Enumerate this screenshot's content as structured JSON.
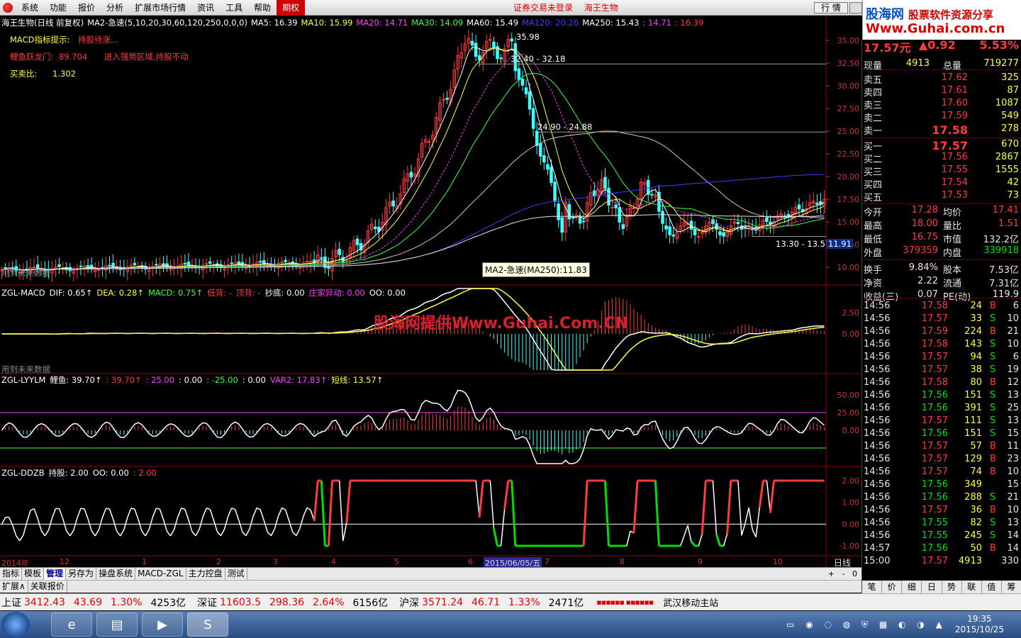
{
  "menu": {
    "items": [
      "系统",
      "功能",
      "报价",
      "分析",
      "扩展市场行情",
      "资讯",
      "工具",
      "帮助",
      "期权"
    ],
    "center_left": "证券交易未登录",
    "center_right": "海王生物",
    "hq_button": "行 情"
  },
  "site_logo": {
    "line1": "股海网",
    "line1_sub": "股票软件资源分享",
    "line2": "Www.Guhai.com.cn"
  },
  "ma_legend": [
    {
      "text": "海王生物(日线 前复权)",
      "color": "#ffffff"
    },
    {
      "text": "MA2-急速(5,10,20,30,60,120,250,0,0,0)",
      "color": "#ffffff"
    },
    {
      "text": "MA5: 16.39",
      "color": "#ffffff"
    },
    {
      "text": "MA10: 15.99",
      "color": "#ffff3c"
    },
    {
      "text": "MA20: 14.71",
      "color": "#ff3cff"
    },
    {
      "text": "MA30: 14.09",
      "color": "#3cff3c"
    },
    {
      "text": "MA60: 15.49",
      "color": "#ffffff"
    },
    {
      "text": "MA120: 20.26",
      "color": "#3c3cff"
    },
    {
      "text": "MA250: 15.43",
      "color": "#ffffff"
    },
    {
      "text": ": 14.71",
      "color": "#ff3cff"
    },
    {
      "text": ": 16.39",
      "color": "#ff3c3c"
    }
  ],
  "notes": [
    {
      "label": "MACD指标提示:",
      "value": "持股待涨...",
      "label_color": "#ffff3c",
      "value_color": "#ff3c3c"
    },
    {
      "label": "鲤鱼跃龙门:",
      "value": "89.704",
      "extra": "进入强势区域,持股不动",
      "label_color": "#ff3c3c",
      "value_color": "#ff3c3c"
    },
    {
      "label": "买卖比:",
      "value": "1.302",
      "label_color": "#ffff3c",
      "value_color": "#ffff3c"
    }
  ],
  "price_annotations": [
    "35.98",
    "32.40 - 32.18",
    "24.90 - 24.88",
    "13.30 - 13.57",
    "11.91"
  ],
  "future_data_note": "用到未来数据",
  "tooltip": "MA2-急速(MA250):11.83",
  "watermark": "股海网提供Www.Guhai.Com.CN",
  "macd_header": [
    {
      "text": "ZGL-MACD",
      "color": "#ffffff"
    },
    {
      "text": "DIF: 0.65↑",
      "color": "#ffffff"
    },
    {
      "text": "DEA: 0.28↑",
      "color": "#ffff3c"
    },
    {
      "text": "MACD: 0.75↑",
      "color": "#3cff3c"
    },
    {
      "text": "低背: -",
      "color": "#ff3c3c"
    },
    {
      "text": "顶背: -",
      "color": "#ff3c3c"
    },
    {
      "text": "抄底: 0.00",
      "color": "#ffffff"
    },
    {
      "text": "庄家异动: 0.00",
      "color": "#ff3cff"
    },
    {
      "text": "OO: 0.00",
      "color": "#ffffff"
    }
  ],
  "lyylm_header": [
    {
      "text": "ZGL-LYYLM",
      "color": "#ffffff"
    },
    {
      "text": "鲤鱼: 39.70↑",
      "color": "#ffffff"
    },
    {
      "text": ": 39.70↑",
      "color": "#ff3c3c"
    },
    {
      "text": ": 25.00",
      "color": "#ff3cff"
    },
    {
      "text": ": 0.00",
      "color": "#ffffff"
    },
    {
      "text": ": -25.00",
      "color": "#3cff3c"
    },
    {
      "text": ": 0.00",
      "color": "#ffffff"
    },
    {
      "text": "VAR2: 17.83↑",
      "color": "#ff3cff"
    },
    {
      "text": "短线: 13.57↑",
      "color": "#ffff3c"
    }
  ],
  "ddzb_header": [
    {
      "text": "ZGL-DDZB",
      "color": "#ffffff"
    },
    {
      "text": "持股: 2.00",
      "color": "#ffffff"
    },
    {
      "text": "OO: 0.00",
      "color": "#ffffff"
    },
    {
      "text": ": 2.00",
      "color": "#ff3c3c"
    }
  ],
  "axes": {
    "price_ticks": [
      "35.00",
      "32.50",
      "30.00",
      "27.50",
      "25.00",
      "22.50",
      "20.00",
      "17.50",
      "15.00",
      "12.50",
      "10.00"
    ],
    "macd_ticks": [
      "2.50",
      "0.00"
    ],
    "lyylm_ticks": [
      "50.00",
      "25.00",
      "0.00"
    ],
    "ddzb_ticks": [
      "2.00",
      "1.00",
      "0.00",
      "-1.00"
    ],
    "x_labels": [
      "2014年",
      "12",
      "1",
      "2",
      "3",
      "4",
      "5",
      "6",
      "2015/06/05/五",
      "7",
      "8",
      "9",
      "10"
    ],
    "period": "日线"
  },
  "bottom_tabs": [
    "指标",
    "模板",
    "管理",
    "另存为",
    "操盘系统",
    "MACD-ZGL",
    "主力控盘",
    "测试"
  ],
  "bottom_tabs2": [
    "扩展∧",
    "关联报价"
  ],
  "bottom_controls": [
    "+",
    "-",
    "0"
  ],
  "quote": {
    "last_price_partial": "17.57元",
    "change_partial": "▲0.92",
    "pct_partial": "5.53%",
    "summary_top": [
      {
        "k1": "现量",
        "v1": "4913",
        "k2": "总量",
        "v2": "719277"
      }
    ],
    "asks": [
      {
        "label": "卖五",
        "price": "17.62",
        "vol": "325"
      },
      {
        "label": "卖四",
        "price": "17.61",
        "vol": "87"
      },
      {
        "label": "卖三",
        "price": "17.60",
        "vol": "1087"
      },
      {
        "label": "卖二",
        "price": "17.59",
        "vol": "549"
      },
      {
        "label": "卖一",
        "price": "17.58",
        "vol": "278"
      }
    ],
    "bids": [
      {
        "label": "买一",
        "price": "17.57",
        "vol": "670"
      },
      {
        "label": "买二",
        "price": "17.56",
        "vol": "2867"
      },
      {
        "label": "买三",
        "price": "17.55",
        "vol": "1555"
      },
      {
        "label": "买四",
        "price": "17.54",
        "vol": "42"
      },
      {
        "label": "买五",
        "price": "17.53",
        "vol": "73"
      }
    ],
    "stats": [
      {
        "k1": "今开",
        "v1": "17.28",
        "c1": "#ff3c3c",
        "k2": "均价",
        "v2": "17.41",
        "c2": "#ff3c3c"
      },
      {
        "k1": "最高",
        "v1": "18.00",
        "c1": "#ff3c3c",
        "k2": "量比",
        "v2": "1.51",
        "c2": "#ff3c3c"
      },
      {
        "k1": "最低",
        "v1": "16.75",
        "c1": "#ff3c3c",
        "k2": "市值",
        "v2": "132.2亿",
        "c2": "#e6e6e6"
      },
      {
        "k1": "外盘",
        "v1": "379359",
        "c1": "#ff3c3c",
        "k2": "内盘",
        "v2": "339918",
        "c2": "#00e000"
      },
      {
        "k1": "换手",
        "v1": "9.84%",
        "c1": "#e6e6e6",
        "k2": "股本",
        "v2": "7.53亿",
        "c2": "#e6e6e6"
      },
      {
        "k1": "净资",
        "v1": "2.22",
        "c1": "#e6e6e6",
        "k2": "流通",
        "v2": "7.31亿",
        "c2": "#e6e6e6"
      },
      {
        "k1": "收益(三)",
        "v1": "0.07",
        "c1": "#e6e6e6",
        "k2": "PE(动)",
        "v2": "119.9",
        "c2": "#e6e6e6"
      }
    ],
    "ticks": [
      {
        "t": "14:56",
        "p": "17.58",
        "v": "24",
        "s": "B",
        "n": "6"
      },
      {
        "t": "14:56",
        "p": "17.57",
        "v": "33",
        "s": "S",
        "n": "10"
      },
      {
        "t": "14:56",
        "p": "17.59",
        "v": "224",
        "s": "B",
        "n": "21"
      },
      {
        "t": "14:56",
        "p": "17.58",
        "v": "143",
        "s": "S",
        "n": "10"
      },
      {
        "t": "14:56",
        "p": "17.57",
        "v": "94",
        "s": "S",
        "n": "6"
      },
      {
        "t": "14:56",
        "p": "17.57",
        "v": "38",
        "s": "S",
        "n": "19"
      },
      {
        "t": "14:56",
        "p": "17.58",
        "v": "80",
        "s": "B",
        "n": "12"
      },
      {
        "t": "14:56",
        "p": "17.56",
        "v": "151",
        "s": "S",
        "n": "13"
      },
      {
        "t": "14:56",
        "p": "17.56",
        "v": "391",
        "s": "S",
        "n": "25"
      },
      {
        "t": "14:56",
        "p": "17.57",
        "v": "111",
        "s": "S",
        "n": "13"
      },
      {
        "t": "14:56",
        "p": "17.56",
        "v": "151",
        "s": "S",
        "n": "15"
      },
      {
        "t": "14:56",
        "p": "17.57",
        "v": "57",
        "s": "B",
        "n": "11"
      },
      {
        "t": "14:56",
        "p": "17.57",
        "v": "129",
        "s": "B",
        "n": "23"
      },
      {
        "t": "14:56",
        "p": "17.57",
        "v": "74",
        "s": "B",
        "n": "10"
      },
      {
        "t": "14:56",
        "p": "17.56",
        "v": "349",
        "s": "",
        "n": "15"
      },
      {
        "t": "14:56",
        "p": "17.56",
        "v": "288",
        "s": "S",
        "n": "21"
      },
      {
        "t": "14:56",
        "p": "17.57",
        "v": "36",
        "s": "B",
        "n": "10"
      },
      {
        "t": "14:56",
        "p": "17.55",
        "v": "82",
        "s": "S",
        "n": "13"
      },
      {
        "t": "14:56",
        "p": "17.55",
        "v": "245",
        "s": "S",
        "n": "14"
      },
      {
        "t": "14:57",
        "p": "17.56",
        "v": "50",
        "s": "B",
        "n": "14"
      },
      {
        "t": "15:00",
        "p": "17.57",
        "v": "4913",
        "s": "",
        "n": "330"
      }
    ],
    "tabs": [
      "笔",
      "价",
      "细",
      "日",
      "势",
      "联",
      "值",
      "筹"
    ]
  },
  "statusbar": [
    {
      "name": "上证",
      "price": "3412.43",
      "chg": "43.69",
      "pct": "1.30%",
      "amt": "4253亿"
    },
    {
      "name": "深证",
      "price": "11603.5",
      "chg": "298.36",
      "pct": "2.64%",
      "amt": "6156亿"
    },
    {
      "name": "沪深",
      "price": "3571.24",
      "chg": "46.71",
      "pct": "1.33%",
      "amt": "2471亿"
    }
  ],
  "status_server": "武汉移动主站",
  "clock": {
    "time": "19:35",
    "date": "2015/10/25"
  },
  "colors": {
    "up": "#ff3c3c",
    "down": "#00e000",
    "ma120": "#3c3cff",
    "grid": "#800000"
  }
}
